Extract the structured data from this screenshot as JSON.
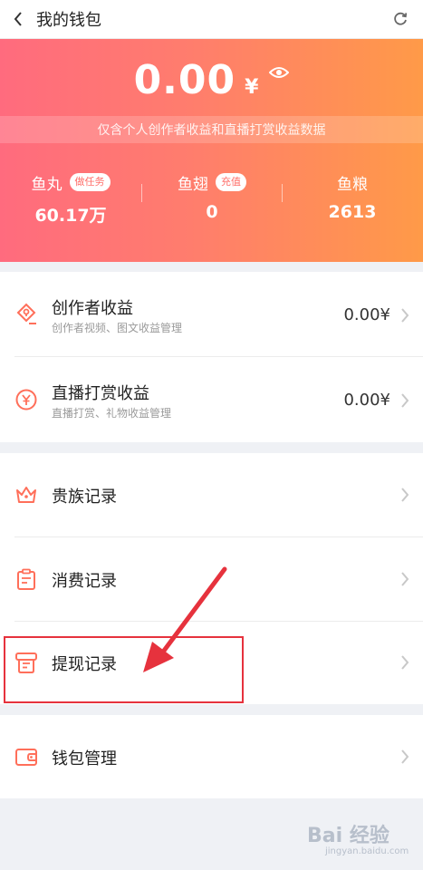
{
  "nav": {
    "back_icon": "chevron-left-icon",
    "title": "我的钱包",
    "refresh_icon": "refresh-icon"
  },
  "header": {
    "balance": "0.00",
    "currency": "¥",
    "eye_icon": "eye-icon",
    "notice": "仅含个人创作者收益和直播打赏收益数据",
    "gradient_start": "#ff6b7e",
    "gradient_end": "#ff9a48",
    "stats": [
      {
        "name": "鱼丸",
        "badge": "做任务",
        "value": "60.17万"
      },
      {
        "name": "鱼翅",
        "badge": "充值",
        "value": "0"
      },
      {
        "name": "鱼粮",
        "badge": "",
        "value": "2613"
      }
    ]
  },
  "earnings": [
    {
      "label": "创作者收益",
      "sub": "创作者视频、图文收益管理",
      "amount": "0.00¥",
      "icon": "diamond-coin-icon"
    },
    {
      "label": "直播打赏收益",
      "sub": "直播打赏、礼物收益管理",
      "amount": "0.00¥",
      "icon": "yen-coin-icon"
    }
  ],
  "records": [
    {
      "label": "贵族记录",
      "icon": "crown-icon"
    },
    {
      "label": "消费记录",
      "icon": "clipboard-icon"
    },
    {
      "label": "提现记录",
      "icon": "withdraw-icon"
    }
  ],
  "wallet": [
    {
      "label": "钱包管理",
      "icon": "wallet-icon"
    }
  ],
  "colors": {
    "accent": "#ff6f5a",
    "annotation": "#e6323d"
  },
  "watermark": {
    "main": "Bai 经验",
    "sub": "jingyan.baidu.com"
  }
}
